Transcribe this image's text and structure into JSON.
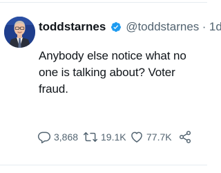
{
  "tweet": {
    "author": {
      "display_name": "toddstarnes",
      "handle": "@toddstarnes",
      "verified": true
    },
    "separator": "·",
    "time": "1d",
    "text": "Anybody else notice what no one is talking about? Voter fraud.",
    "actions": {
      "replies": "3,868",
      "retweets": "19.1K",
      "likes": "77.7K"
    }
  },
  "icons": {
    "verified": "verified-badge-icon",
    "reply": "reply-icon",
    "retweet": "retweet-icon",
    "like": "heart-icon",
    "share": "share-icon"
  },
  "colors": {
    "verified_blue": "#1d9bf0",
    "text_primary": "#0f1419",
    "text_secondary": "#536471"
  }
}
